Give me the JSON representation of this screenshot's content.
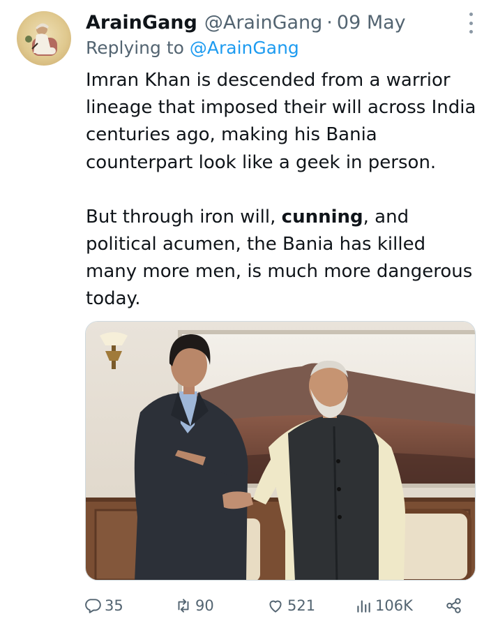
{
  "tweet": {
    "display_name": "ArainGang",
    "handle": "@ArainGang",
    "separator": "·",
    "date": "09 May",
    "replying_prefix": "Replying to",
    "replying_handle": "@ArainGang",
    "paragraph1": "Imran Khan is descended from a warrior lineage that imposed their will across India centuries ago, making his Bania counterpart look like a geek in person.",
    "paragraph2_before": "But through iron will, ",
    "paragraph2_bold": "cunning",
    "paragraph2_after": ", and political acumen, the Bania has killed many more men, is much more dangerous today."
  },
  "actions": {
    "replies": "35",
    "retweets": "90",
    "likes": "521",
    "views": "106K"
  },
  "icons": [
    "more-icon",
    "reply-icon",
    "retweet-icon",
    "like-icon",
    "views-icon",
    "share-icon"
  ],
  "colors": {
    "text": "#0f1419",
    "secondary": "#536471",
    "link": "#1d9bf0"
  }
}
